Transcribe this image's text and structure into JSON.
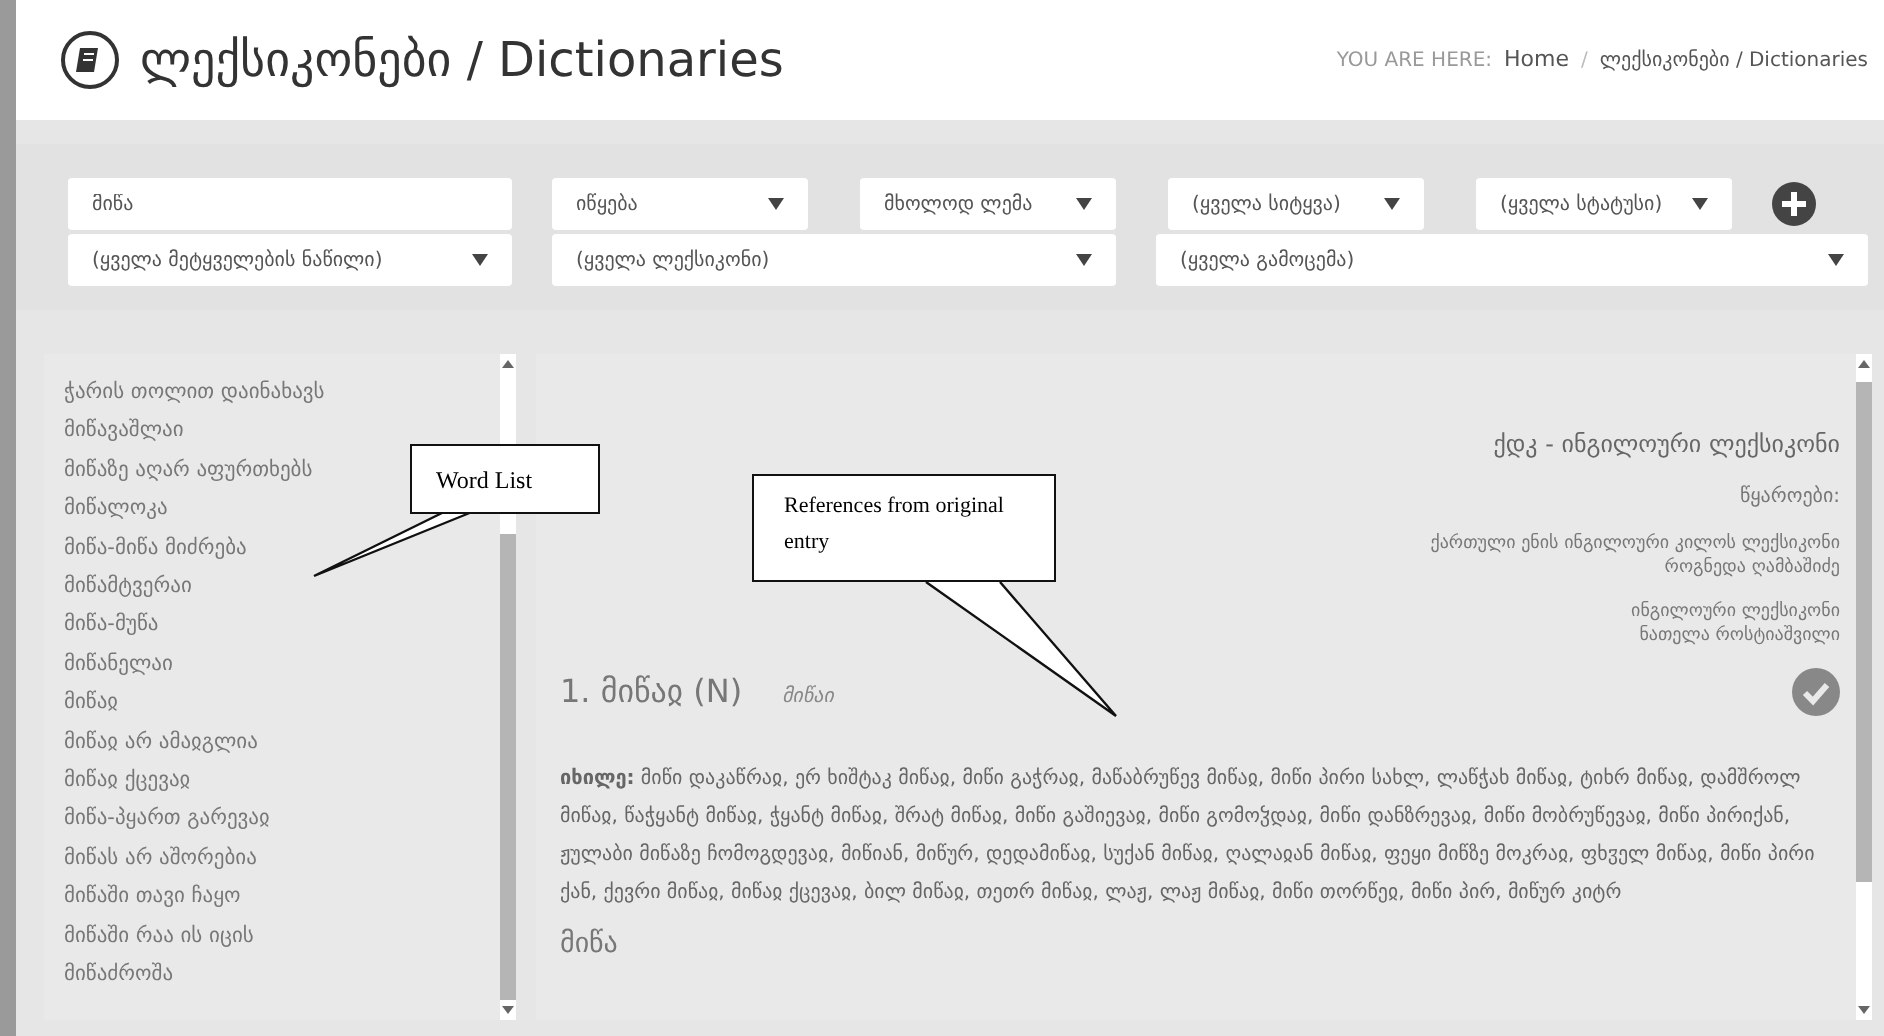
{
  "header": {
    "title": "ლექსიკონები / Dictionaries",
    "breadcrumb": {
      "label": "YOU ARE HERE:",
      "separator": "/",
      "items": [
        "Home",
        "ლექსიკონები / Dictionaries"
      ]
    }
  },
  "filters": {
    "search": {
      "value": "მიწა"
    },
    "row_1": [
      {
        "value": "იწყება",
        "kind": "select"
      },
      {
        "value": "მხოლოდ ლემა",
        "kind": "select"
      },
      {
        "value": "(ყველა სიტყვა)",
        "kind": "select"
      },
      {
        "value": "(ყველა სტატუსი)",
        "kind": "select"
      }
    ],
    "row_2": [
      {
        "value": "(ყველა მეტყველების ნაწილი)",
        "kind": "select"
      },
      {
        "value": "(ყველა ლექსიკონი)",
        "kind": "select"
      },
      {
        "value": "(ყველა გამოცემა)",
        "kind": "select"
      }
    ]
  },
  "word_list": [
    "ჭარის თოლით დაინახავს",
    "მიწავაშლაი",
    "მიწაზე აღარ აფურთხებს",
    "მიწალოკა",
    "მიწა-მიწა მიძრება",
    "მიწამტვერაი",
    "მიწა-მუწა",
    "მიწანელაი",
    "მიწაჲ",
    "მიწაჲ არ ამაჲგლია",
    "მიწაჲ ქცევაჲ",
    "მიწა-პყართ გარევაჲ",
    "მიწას არ აშორებია",
    "მიწაში თავი ჩაყო",
    "მიწაში რაა ის იცის",
    "მიწაძროშა"
  ],
  "entry": {
    "dictionary": "ქდკ - ინგილოური ლექსიკონი",
    "sources_label": "წყაროები:",
    "sources": [
      [
        "ქართული ენის ინგილოური კილოს ლექსიკონი",
        "როგნედა ღამბაშიძე"
      ],
      [
        "ინგილოური ლექსიკონი",
        "ნათელა როსტიაშვილი"
      ]
    ],
    "verified": true,
    "headword": "1. მიწაჲ (N)",
    "variant": "მიწაი",
    "see_also": "**იხილე:** მიწი დაკაწრაჲ, ერ ხიშტაკ მიწაჲ, მიწი გაჭრაჲ, მაწაბრუწევ მიწაჲ, მიწი პირი სახლ, ლაწჭახ მიწაჲ, ტიხრ მიწაჲ, დამშროლ მიწაჲ, წაჭყანტ მიწაჲ, ჭყანტ მიწაჲ, შრატ მიწაჲ, მიწი გაშიევაჲ, მიწი გომოჴდაჲ, მიწი დანზრევაჲ, მიწი მობრუწევაჲ, მიწი პირიქან, ჟულაბი მიწაზე ჩომოგდევაჲ, მიწიან, მიწურ, დედამიწაჲ, სუქან მიწაჲ, ღალაჲან მიწაჲ, ფეყი მიწზე მოკრაჲ, ფხჳელ მიწაჲ, მიწი პირი ქან, ქევრი მიწაჲ, მიწაჲ ქცევაჲ, ბილ მიწაჲ, თეთრ მიწაჲ, ლაჟ, ლაჟ მიწაჲ, მიწი თორწეჲ, მიწი პირ, მიწურ კიტრ",
    "next_heading": "მიწა"
  },
  "annotations": [
    "Word List",
    "References from original entry"
  ]
}
